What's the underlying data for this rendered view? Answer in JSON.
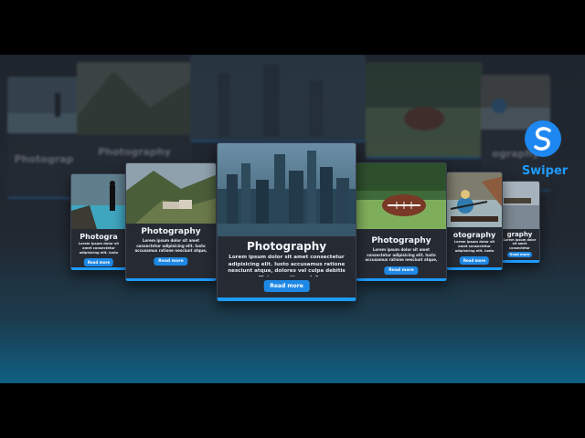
{
  "brand": {
    "name": "Swiper",
    "color": "#1e88f0",
    "icon": "swiper-s-logo-icon"
  },
  "ghost_titles": {
    "left": "Photograp",
    "center_left": "Photography",
    "right": "ography"
  },
  "cards": {
    "far_left": {
      "title": "Photogra",
      "text": "Lorem ipsum dolor sit amet consectetur adipisicing elit. Iusto accusamus ratione nesciunt atque, dolores vel culpa debitis officia expedita unde?",
      "button": "Read more",
      "image": "person-on-rock-by-lake"
    },
    "left": {
      "title": "Photography",
      "text": "Lorem ipsum dolor sit amet consectetur adipisicing elit. Iusto accusamus ratione nesciunt atque, dolores vel culpa debitis officia expedita unde?",
      "button": "Read more",
      "image": "mountain-village-aerial"
    },
    "center": {
      "title": "Photography",
      "text": "Lorem ipsum dolor sit amet consectetur adipisicing elit. Iusto accusamus ratione nesciunt atque, dolores vel culpa debitis officia expedita unde?",
      "button": "Read more",
      "image": "city-skyline-aerial"
    },
    "right": {
      "title": "Photography",
      "text": "Lorem ipsum dolor sit amet consectetur adipisicing elit. Iusto accusamus ratione nesciunt atque, dolores vel culpa debitis officia expedita unde?",
      "button": "Read more",
      "image": "football-on-grass"
    },
    "far_right": {
      "title": "otography",
      "text": "Lorem ipsum dolor sit amet consectetur adipisicing elit. Iusto accusamus ratione nesciunt atque, dolores vel culpa debitis officia expedita unde?",
      "button": "Read more",
      "image": "person-in-kayak"
    },
    "edge_right": {
      "title": "graphy",
      "text": "Lorem ipsum dolor sit amet consectetur adipisicing elit. Iusto accusamus ratione nesciunt atque, dolores vel culpa debitis officia expedita unde?",
      "button": "Read more",
      "image": "lakeside-dock"
    }
  },
  "colors": {
    "accent": "#1e88e5",
    "card_bg": "#262b33",
    "page_bg": "#222831"
  }
}
